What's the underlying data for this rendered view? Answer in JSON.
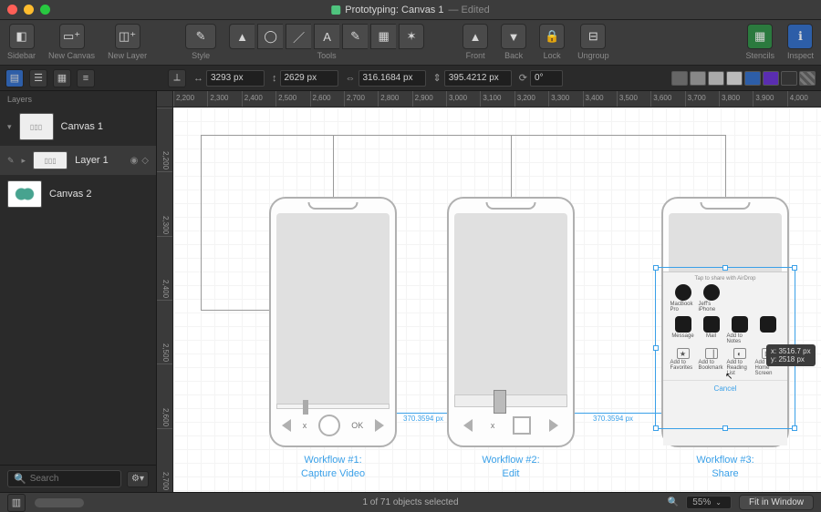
{
  "title": {
    "name": "Prototyping: Canvas 1",
    "suffix": "— Edited"
  },
  "toolbar": {
    "sidebar": "Sidebar",
    "new_canvas": "New Canvas",
    "new_layer": "New Layer",
    "style": "Style",
    "tools": "Tools",
    "front": "Front",
    "back": "Back",
    "lock": "Lock",
    "ungroup": "Ungroup",
    "stencils": "Stencils",
    "inspect": "Inspect"
  },
  "coords": {
    "x": "3293 px",
    "y": "2629 px",
    "w": "316.1684 px",
    "h": "395.4212 px",
    "rot": "0°"
  },
  "ruler_h": [
    "2,200",
    "2,300",
    "2,400",
    "2,500",
    "2,600",
    "2,700",
    "2,800",
    "2,900",
    "3,000",
    "3,100",
    "3,200",
    "3,300",
    "3,400",
    "3,500",
    "3,600",
    "3,700",
    "3,800",
    "3,900",
    "4,000"
  ],
  "ruler_v": [
    "2,200",
    "2,300",
    "2,400",
    "2,500",
    "2,600",
    "2,700"
  ],
  "sidebar": {
    "heading": "Layers",
    "items": [
      {
        "name": "Canvas 1",
        "selected": false
      },
      {
        "name": "Layer 1",
        "selected": true
      },
      {
        "name": "Canvas 2",
        "selected": false
      }
    ],
    "search_placeholder": "Search"
  },
  "workflows": [
    {
      "title1": "Workflow #1:",
      "title2": "Capture Video",
      "ok": "OK",
      "x": "x"
    },
    {
      "title1": "Workflow #2:",
      "title2": "Edit"
    },
    {
      "title1": "Workflow #3:",
      "title2": "Share",
      "share": {
        "header": "Tap to share with AirDrop",
        "airdrop": [
          {
            "l1": "MacBook Pro"
          },
          {
            "l1": "Jeff's iPhone"
          }
        ],
        "apps": [
          {
            "l": "Message"
          },
          {
            "l": "Mail"
          },
          {
            "l": "Add to Notes"
          },
          {
            "l": ""
          }
        ],
        "actions": [
          {
            "l": "Add to Favorites",
            "g": "★"
          },
          {
            "l": "Add to Bookmark",
            "g": "▕"
          },
          {
            "l": "Add to Reading List",
            "g": "◐"
          },
          {
            "l": "Add to Home Screen",
            "g": "⊞"
          }
        ],
        "cancel": "Cancel"
      }
    }
  ],
  "dims": {
    "d12": "370.3594 px",
    "d23": "370.3594 px"
  },
  "tooltip": {
    "x": "x: 3516.7 px",
    "y": "y: 2518 px"
  },
  "status": {
    "selection": "1 of 71 objects selected",
    "zoom": "55%",
    "fit": "Fit in Window"
  }
}
